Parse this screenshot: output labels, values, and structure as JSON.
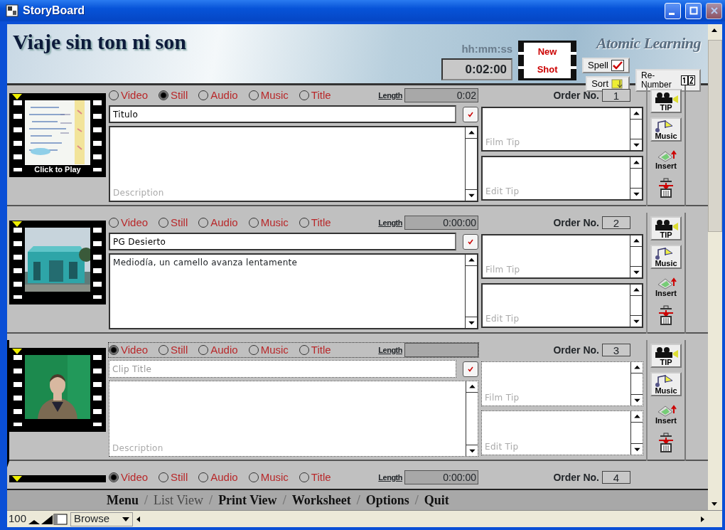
{
  "window": {
    "title": "StoryBoard"
  },
  "header": {
    "project_title": "Viaje sin ton ni son",
    "time_label": "hh:mm:ss",
    "total_time": "0:02:00",
    "new_shot": [
      "New",
      "Shot"
    ],
    "logo": "Atomic Learning",
    "spell": "Spell",
    "sort": "Sort",
    "renumber": "Re-Number"
  },
  "rows": [
    {
      "current": false,
      "thumbnail": {
        "kind": "picture",
        "caption": "Click to Play"
      },
      "media": [
        {
          "label": "Video",
          "selected": false
        },
        {
          "label": "Still",
          "selected": true
        },
        {
          "label": "Audio",
          "selected": false
        },
        {
          "label": "Music",
          "selected": false
        },
        {
          "label": "Title",
          "selected": false
        }
      ],
      "length_label": "Length",
      "length": "0:02",
      "order_label": "Order No.",
      "order": "1",
      "title": {
        "value": "Titulo"
      },
      "spell_checked": true,
      "description": {
        "placeholder": "Description"
      },
      "film_tip": {
        "placeholder": "Film Tip"
      },
      "edit_tip": {
        "placeholder": "Edit Tip"
      },
      "tools": [
        "TIP",
        "Music",
        "Insert"
      ]
    },
    {
      "current": false,
      "thumbnail": {
        "kind": "picture"
      },
      "media": [
        {
          "label": "Video",
          "selected": false
        },
        {
          "label": "Still",
          "selected": false
        },
        {
          "label": "Audio",
          "selected": false
        },
        {
          "label": "Music",
          "selected": false
        },
        {
          "label": "Title",
          "selected": false
        }
      ],
      "length_label": "Length",
      "length": "0:00:00",
      "order_label": "Order No.",
      "order": "2",
      "title": {
        "value": "PG Desierto"
      },
      "spell_checked": true,
      "description": {
        "value": "Mediodía, un camello avanza lentamente"
      },
      "film_tip": {
        "placeholder": "Film Tip"
      },
      "edit_tip": {
        "placeholder": "Edit Tip"
      },
      "tools": [
        "TIP",
        "Music",
        "Insert"
      ]
    },
    {
      "current": true,
      "thumbnail": {
        "kind": "picture"
      },
      "media": [
        {
          "label": "Video",
          "selected": true
        },
        {
          "label": "Still",
          "selected": false
        },
        {
          "label": "Audio",
          "selected": false
        },
        {
          "label": "Music",
          "selected": false
        },
        {
          "label": "Title",
          "selected": false
        }
      ],
      "length_label": "Length",
      "order_label": "Order No.",
      "order": "3",
      "title": {
        "placeholder": "Clip Title"
      },
      "spell_checked": true,
      "description": {
        "placeholder": "Description"
      },
      "film_tip": {
        "placeholder": "Film Tip"
      },
      "edit_tip": {
        "placeholder": "Edit Tip"
      },
      "tools": [
        "TIP",
        "Music",
        "Insert"
      ]
    },
    {
      "current": false,
      "media": [
        {
          "label": "Video",
          "selected": true
        },
        {
          "label": "Still",
          "selected": false
        },
        {
          "label": "Audio",
          "selected": false
        },
        {
          "label": "Music",
          "selected": false
        },
        {
          "label": "Title",
          "selected": false
        }
      ],
      "length_label": "Length",
      "length": "0:00:00",
      "order_label": "Order No.",
      "order": "4"
    }
  ],
  "menu": [
    {
      "label": "Menu",
      "disabled": false,
      "separator": "/"
    },
    {
      "label": "List View",
      "disabled": true,
      "separator": "/"
    },
    {
      "label": "Print View",
      "disabled": false,
      "separator": "/"
    },
    {
      "label": "Worksheet",
      "disabled": false,
      "separator": "/"
    },
    {
      "label": "Options",
      "disabled": false,
      "separator": "/"
    },
    {
      "label": "Quit",
      "disabled": false
    }
  ],
  "status_bar": {
    "zoom": "100",
    "mode": "Browse"
  }
}
